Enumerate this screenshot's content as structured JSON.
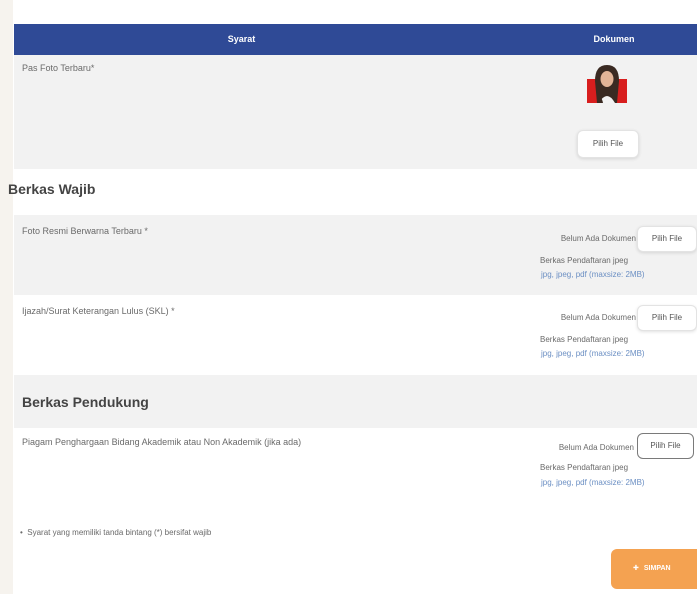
{
  "table": {
    "col_requirement": "Syarat",
    "col_document": "Dokumen"
  },
  "pas_foto": {
    "label": "Pas Foto Terbaru*",
    "button": "Pilih File"
  },
  "berkas_wajib": {
    "title": "Berkas Wajib",
    "items": [
      {
        "label": "Foto Resmi Berwarna Terbaru *",
        "status": "Belum Ada Dokumen",
        "button": "Pilih File",
        "hint": "Berkas Pendaftaran jpeg",
        "formats": "jpg, jpeg, pdf (maxsize: 2MB)"
      },
      {
        "label": "Ijazah/Surat Keterangan Lulus (SKL) *",
        "status": "Belum Ada Dokumen",
        "button": "Pilih File",
        "hint": "Berkas Pendaftaran jpeg",
        "formats": "jpg, jpeg, pdf (maxsize: 2MB)"
      }
    ]
  },
  "berkas_pendukung": {
    "title": "Berkas Pendukung",
    "items": [
      {
        "label": "Piagam Penghargaan Bidang Akademik atau Non Akademik (jika ada)",
        "status": "Belum Ada Dokumen",
        "button": "Pilih File",
        "hint": "Berkas Pendaftaran jpeg",
        "formats": "jpg, jpeg, pdf (maxsize: 2MB)"
      }
    ]
  },
  "note": "Syarat yang memiliki tanda bintang (*) bersifat wajib",
  "save_button": "SIMPAN",
  "colors": {
    "header": "#2f4a96",
    "save": "#f4a251",
    "link": "#6b8fc3"
  }
}
